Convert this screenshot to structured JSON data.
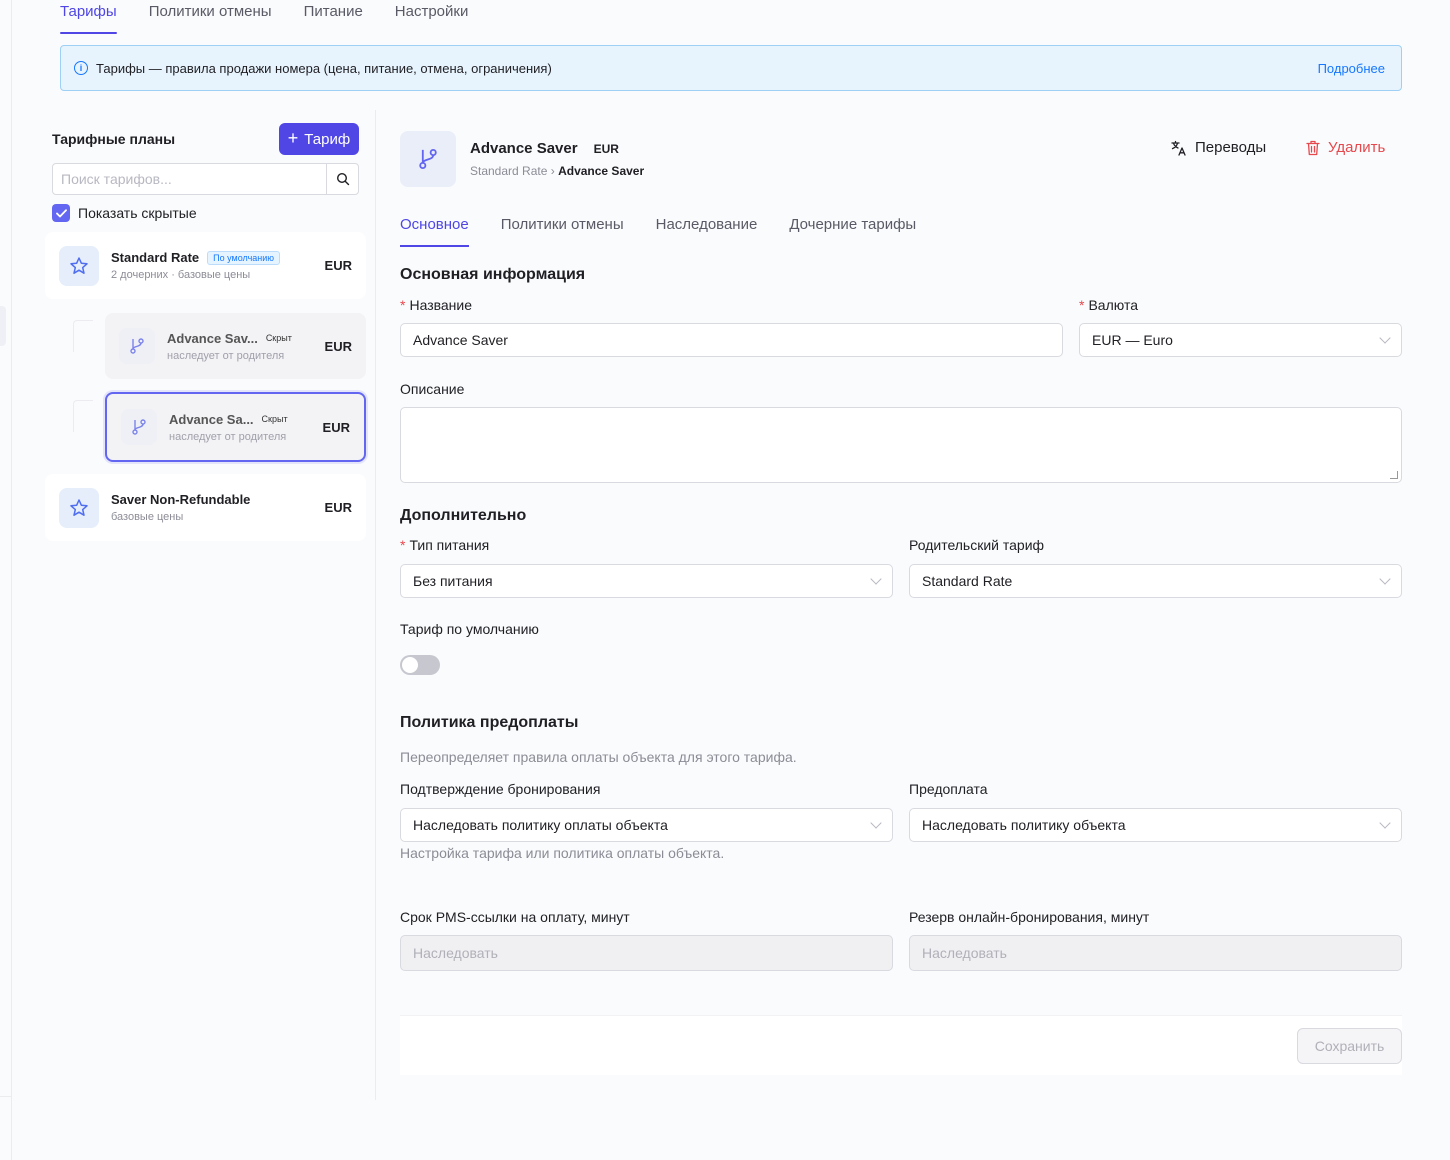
{
  "top_tabs": [
    {
      "label": "Тарифы",
      "active": true
    },
    {
      "label": "Политики отмены",
      "active": false
    },
    {
      "label": "Питание",
      "active": false
    },
    {
      "label": "Настройки",
      "active": false
    }
  ],
  "banner": {
    "icon": "info-icon",
    "text": "Тарифы — правила продажи номера (цена, питание, отмена, ограничения)",
    "link": "Подробнее"
  },
  "sidebar": {
    "title": "Тарифные планы",
    "add_button": "Тариф",
    "search_placeholder": "Поиск тарифов...",
    "show_hidden_label": "Показать скрытые",
    "show_hidden_checked": true,
    "rates": [
      {
        "name": "Standard Rate",
        "badge": "По умолчанию",
        "sub": "2 дочерних · базовые цены",
        "currency": "EUR",
        "icon": "star-icon"
      },
      {
        "name": "Advance Sav...",
        "badge": "Скрыт",
        "sub": "наследует от родителя",
        "currency": "EUR",
        "icon": "branch-icon"
      },
      {
        "name": "Advance Sa...",
        "badge": "Скрыт",
        "sub": "наследует от родителя",
        "currency": "EUR",
        "icon": "branch-icon",
        "selected": true
      },
      {
        "name": "Saver Non-Refundable",
        "sub": "базовые цены",
        "currency": "EUR",
        "icon": "star-icon"
      }
    ]
  },
  "header": {
    "title": "Advance Saver",
    "currency": "EUR",
    "breadcrumb_parent": "Standard Rate",
    "breadcrumb_sep": "›",
    "breadcrumb_current": "Advance Saver",
    "translations_label": "Переводы",
    "delete_label": "Удалить"
  },
  "inner_tabs": [
    {
      "label": "Основное",
      "active": true
    },
    {
      "label": "Политики отмены",
      "active": false
    },
    {
      "label": "Наследование",
      "active": false
    },
    {
      "label": "Дочерние тарифы",
      "active": false
    }
  ],
  "basic": {
    "heading": "Основная информация",
    "name_label": "Название",
    "name_value": "Advance Saver",
    "currency_label": "Валюта",
    "currency_value": "EUR — Euro",
    "description_label": "Описание",
    "description_value": ""
  },
  "extra": {
    "heading": "Дополнительно",
    "meal_label": "Тип питания",
    "meal_value": "Без питания",
    "parent_label": "Родительский тариф",
    "parent_value": "Standard Rate",
    "default_label": "Тариф по умолчанию",
    "default_on": false
  },
  "prepay": {
    "heading": "Политика предоплаты",
    "description": "Переопределяет правила оплаты объекта для этого тарифа.",
    "confirm_label": "Подтверждение бронирования",
    "confirm_value": "Наследовать политику оплаты объекта",
    "confirm_helper": "Настройка тарифа или политика оплаты объекта.",
    "prepay_label": "Предоплата",
    "prepay_value": "Наследовать политику объекта",
    "pms_label": "Срок PMS-ссылки на оплату, минут",
    "pms_placeholder": "Наследовать",
    "reserve_label": "Резерв онлайн-бронирования, минут",
    "reserve_placeholder": "Наследовать"
  },
  "footer": {
    "save_label": "Сохранить"
  },
  "colors": {
    "accent": "#4f46e5",
    "danger": "#e5484d",
    "info": "#1677ff"
  }
}
